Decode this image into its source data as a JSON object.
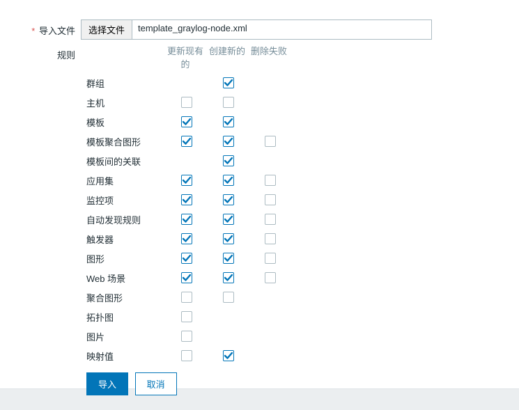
{
  "labels": {
    "import_file": "导入文件",
    "choose_file_btn": "选择文件",
    "filename": "template_graylog-node.xml",
    "rules": "规则"
  },
  "columns": {
    "update_existing": "更新现有的",
    "create_new": "创建新的",
    "delete_missing": "删除失败"
  },
  "buttons": {
    "import": "导入",
    "cancel": "取消"
  },
  "rules_rows": [
    {
      "name": "群组",
      "cells": [
        null,
        true,
        null
      ]
    },
    {
      "name": "主机",
      "cells": [
        false,
        false,
        null
      ]
    },
    {
      "name": "模板",
      "cells": [
        true,
        true,
        null
      ]
    },
    {
      "name": "模板聚合图形",
      "cells": [
        true,
        true,
        false
      ]
    },
    {
      "name": "模板间的关联",
      "cells": [
        null,
        true,
        null
      ]
    },
    {
      "name": "应用集",
      "cells": [
        true,
        true,
        false
      ]
    },
    {
      "name": "监控项",
      "cells": [
        true,
        true,
        false
      ]
    },
    {
      "name": "自动发现规则",
      "cells": [
        true,
        true,
        false
      ]
    },
    {
      "name": "触发器",
      "cells": [
        true,
        true,
        false
      ]
    },
    {
      "name": "图形",
      "cells": [
        true,
        true,
        false
      ]
    },
    {
      "name": "Web 场景",
      "cells": [
        true,
        true,
        false
      ]
    },
    {
      "name": "聚合图形",
      "cells": [
        false,
        false,
        null
      ]
    },
    {
      "name": "拓扑图",
      "cells": [
        false,
        null,
        null
      ]
    },
    {
      "name": "图片",
      "cells": [
        false,
        null,
        null
      ]
    },
    {
      "name": "映射值",
      "cells": [
        false,
        true,
        null
      ]
    }
  ]
}
